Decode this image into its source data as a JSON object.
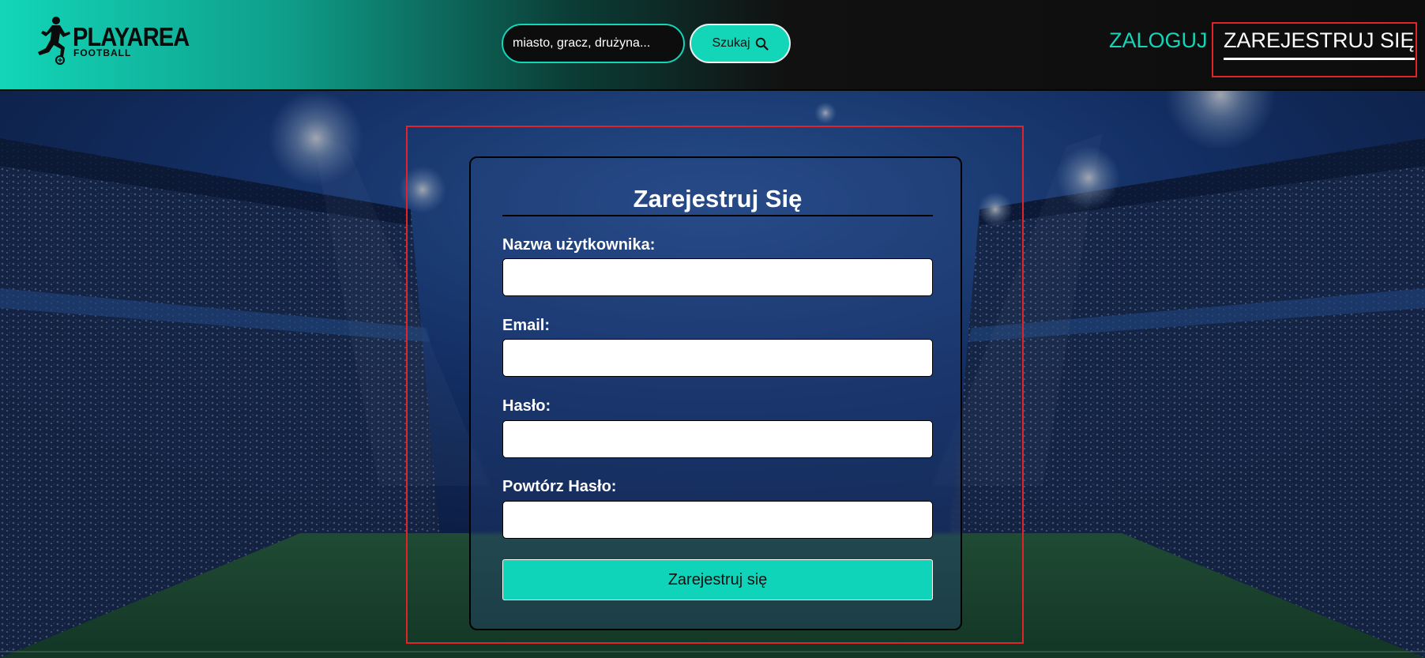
{
  "header": {
    "logo": {
      "title": "PLAYAREA",
      "subtitle": "FOOTBALL"
    },
    "search": {
      "placeholder": "miasto, gracz, drużyna...",
      "button_label": "Szukaj"
    },
    "nav": {
      "login_label": "ZALOGUJ",
      "register_label": "ZAREJESTRUJ SIĘ"
    }
  },
  "form": {
    "title": "Zarejestruj Się",
    "fields": [
      {
        "label": "Nazwa użytkownika:",
        "value": ""
      },
      {
        "label": "Email:",
        "value": ""
      },
      {
        "label": "Hasło:",
        "value": ""
      },
      {
        "label": "Powtórz Hasło:",
        "value": ""
      }
    ],
    "submit_label": "Zarejestruj się"
  },
  "colors": {
    "accent": "#13d6b8",
    "highlight": "#e0242a",
    "header_dark": "#0d0d0d"
  },
  "icons": {
    "search": "search-icon",
    "logo": "football-player-icon"
  }
}
